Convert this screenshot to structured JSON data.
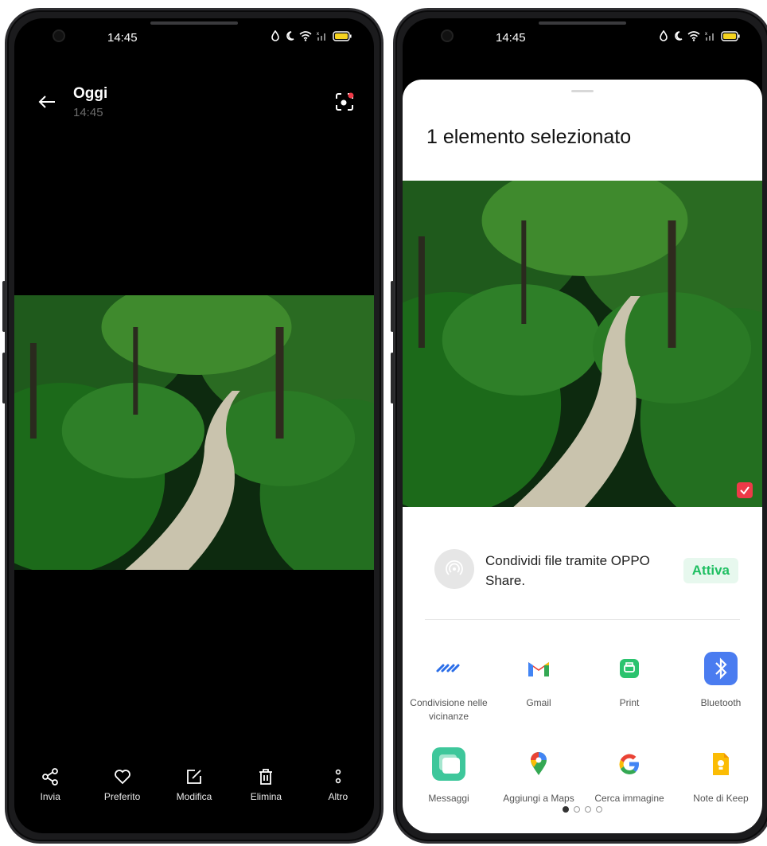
{
  "left_phone": {
    "status": {
      "time": "14:45"
    },
    "header": {
      "title": "Oggi",
      "subtitle": "14:45"
    },
    "toolbar": [
      {
        "label": "Invia",
        "icon": "share-icon"
      },
      {
        "label": "Preferito",
        "icon": "heart-icon"
      },
      {
        "label": "Modifica",
        "icon": "edit-icon"
      },
      {
        "label": "Elimina",
        "icon": "trash-icon"
      },
      {
        "label": "Altro",
        "icon": "more-icon"
      }
    ]
  },
  "right_phone": {
    "status": {
      "time": "14:45"
    },
    "sheet": {
      "title": "1 elemento selezionato",
      "share_text": "Condividi file tramite OPPO Share.",
      "share_action": "Attiva",
      "apps": [
        {
          "label": "Condivisione nelle vicinanze",
          "icon": "nearby-share-icon"
        },
        {
          "label": "Gmail",
          "icon": "gmail-icon"
        },
        {
          "label": "Print",
          "icon": "print-icon"
        },
        {
          "label": "Bluetooth",
          "icon": "bluetooth-icon"
        },
        {
          "label": "Messaggi",
          "icon": "messages-icon"
        },
        {
          "label": "Aggiungi a Maps",
          "icon": "maps-icon"
        },
        {
          "label": "Cerca immagine",
          "icon": "google-icon"
        },
        {
          "label": "Note di Keep",
          "icon": "keep-icon"
        }
      ],
      "pager": {
        "pages": 4,
        "current": 1
      }
    }
  },
  "colors": {
    "accent_green": "#1fbf62",
    "check_red": "#ee3a48",
    "bluetooth_blue": "#4a7cf0"
  }
}
